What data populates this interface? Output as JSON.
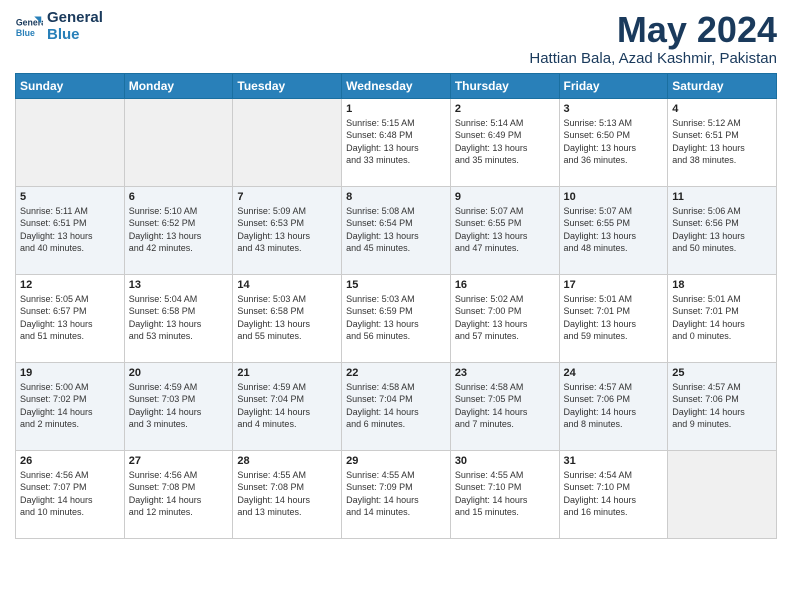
{
  "logo": {
    "line1": "General",
    "line2": "Blue"
  },
  "title": "May 2024",
  "location": "Hattian Bala, Azad Kashmir, Pakistan",
  "days_of_week": [
    "Sunday",
    "Monday",
    "Tuesday",
    "Wednesday",
    "Thursday",
    "Friday",
    "Saturday"
  ],
  "weeks": [
    [
      {
        "day": "",
        "info": ""
      },
      {
        "day": "",
        "info": ""
      },
      {
        "day": "",
        "info": ""
      },
      {
        "day": "1",
        "info": "Sunrise: 5:15 AM\nSunset: 6:48 PM\nDaylight: 13 hours\nand 33 minutes."
      },
      {
        "day": "2",
        "info": "Sunrise: 5:14 AM\nSunset: 6:49 PM\nDaylight: 13 hours\nand 35 minutes."
      },
      {
        "day": "3",
        "info": "Sunrise: 5:13 AM\nSunset: 6:50 PM\nDaylight: 13 hours\nand 36 minutes."
      },
      {
        "day": "4",
        "info": "Sunrise: 5:12 AM\nSunset: 6:51 PM\nDaylight: 13 hours\nand 38 minutes."
      }
    ],
    [
      {
        "day": "5",
        "info": "Sunrise: 5:11 AM\nSunset: 6:51 PM\nDaylight: 13 hours\nand 40 minutes."
      },
      {
        "day": "6",
        "info": "Sunrise: 5:10 AM\nSunset: 6:52 PM\nDaylight: 13 hours\nand 42 minutes."
      },
      {
        "day": "7",
        "info": "Sunrise: 5:09 AM\nSunset: 6:53 PM\nDaylight: 13 hours\nand 43 minutes."
      },
      {
        "day": "8",
        "info": "Sunrise: 5:08 AM\nSunset: 6:54 PM\nDaylight: 13 hours\nand 45 minutes."
      },
      {
        "day": "9",
        "info": "Sunrise: 5:07 AM\nSunset: 6:55 PM\nDaylight: 13 hours\nand 47 minutes."
      },
      {
        "day": "10",
        "info": "Sunrise: 5:07 AM\nSunset: 6:55 PM\nDaylight: 13 hours\nand 48 minutes."
      },
      {
        "day": "11",
        "info": "Sunrise: 5:06 AM\nSunset: 6:56 PM\nDaylight: 13 hours\nand 50 minutes."
      }
    ],
    [
      {
        "day": "12",
        "info": "Sunrise: 5:05 AM\nSunset: 6:57 PM\nDaylight: 13 hours\nand 51 minutes."
      },
      {
        "day": "13",
        "info": "Sunrise: 5:04 AM\nSunset: 6:58 PM\nDaylight: 13 hours\nand 53 minutes."
      },
      {
        "day": "14",
        "info": "Sunrise: 5:03 AM\nSunset: 6:58 PM\nDaylight: 13 hours\nand 55 minutes."
      },
      {
        "day": "15",
        "info": "Sunrise: 5:03 AM\nSunset: 6:59 PM\nDaylight: 13 hours\nand 56 minutes."
      },
      {
        "day": "16",
        "info": "Sunrise: 5:02 AM\nSunset: 7:00 PM\nDaylight: 13 hours\nand 57 minutes."
      },
      {
        "day": "17",
        "info": "Sunrise: 5:01 AM\nSunset: 7:01 PM\nDaylight: 13 hours\nand 59 minutes."
      },
      {
        "day": "18",
        "info": "Sunrise: 5:01 AM\nSunset: 7:01 PM\nDaylight: 14 hours\nand 0 minutes."
      }
    ],
    [
      {
        "day": "19",
        "info": "Sunrise: 5:00 AM\nSunset: 7:02 PM\nDaylight: 14 hours\nand 2 minutes."
      },
      {
        "day": "20",
        "info": "Sunrise: 4:59 AM\nSunset: 7:03 PM\nDaylight: 14 hours\nand 3 minutes."
      },
      {
        "day": "21",
        "info": "Sunrise: 4:59 AM\nSunset: 7:04 PM\nDaylight: 14 hours\nand 4 minutes."
      },
      {
        "day": "22",
        "info": "Sunrise: 4:58 AM\nSunset: 7:04 PM\nDaylight: 14 hours\nand 6 minutes."
      },
      {
        "day": "23",
        "info": "Sunrise: 4:58 AM\nSunset: 7:05 PM\nDaylight: 14 hours\nand 7 minutes."
      },
      {
        "day": "24",
        "info": "Sunrise: 4:57 AM\nSunset: 7:06 PM\nDaylight: 14 hours\nand 8 minutes."
      },
      {
        "day": "25",
        "info": "Sunrise: 4:57 AM\nSunset: 7:06 PM\nDaylight: 14 hours\nand 9 minutes."
      }
    ],
    [
      {
        "day": "26",
        "info": "Sunrise: 4:56 AM\nSunset: 7:07 PM\nDaylight: 14 hours\nand 10 minutes."
      },
      {
        "day": "27",
        "info": "Sunrise: 4:56 AM\nSunset: 7:08 PM\nDaylight: 14 hours\nand 12 minutes."
      },
      {
        "day": "28",
        "info": "Sunrise: 4:55 AM\nSunset: 7:08 PM\nDaylight: 14 hours\nand 13 minutes."
      },
      {
        "day": "29",
        "info": "Sunrise: 4:55 AM\nSunset: 7:09 PM\nDaylight: 14 hours\nand 14 minutes."
      },
      {
        "day": "30",
        "info": "Sunrise: 4:55 AM\nSunset: 7:10 PM\nDaylight: 14 hours\nand 15 minutes."
      },
      {
        "day": "31",
        "info": "Sunrise: 4:54 AM\nSunset: 7:10 PM\nDaylight: 14 hours\nand 16 minutes."
      },
      {
        "day": "",
        "info": ""
      }
    ]
  ]
}
